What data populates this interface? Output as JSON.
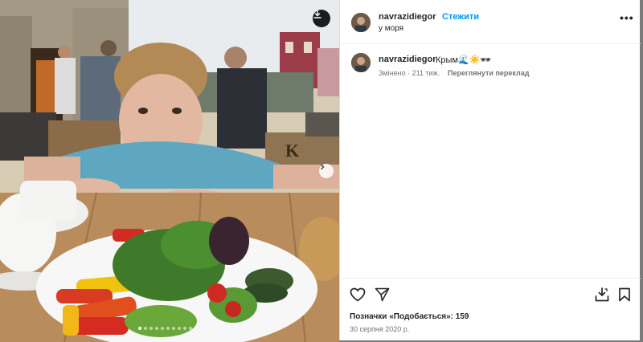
{
  "post": {
    "username": "navrazidiegor",
    "follow_label": "Стежити",
    "separator": "•",
    "location": "у моря",
    "more_label": "•••"
  },
  "caption": {
    "username": "navrazidiegor",
    "text": "Крым🌊☀️🕶",
    "edited": "Змінено · 211 тиж.",
    "translate_label": "Переглянути переклад"
  },
  "media": {
    "carousel_count": 10,
    "active_index": 0
  },
  "footer": {
    "likes": "Позначки «Подобається»: 159",
    "date": "30 серпня 2020 р."
  }
}
